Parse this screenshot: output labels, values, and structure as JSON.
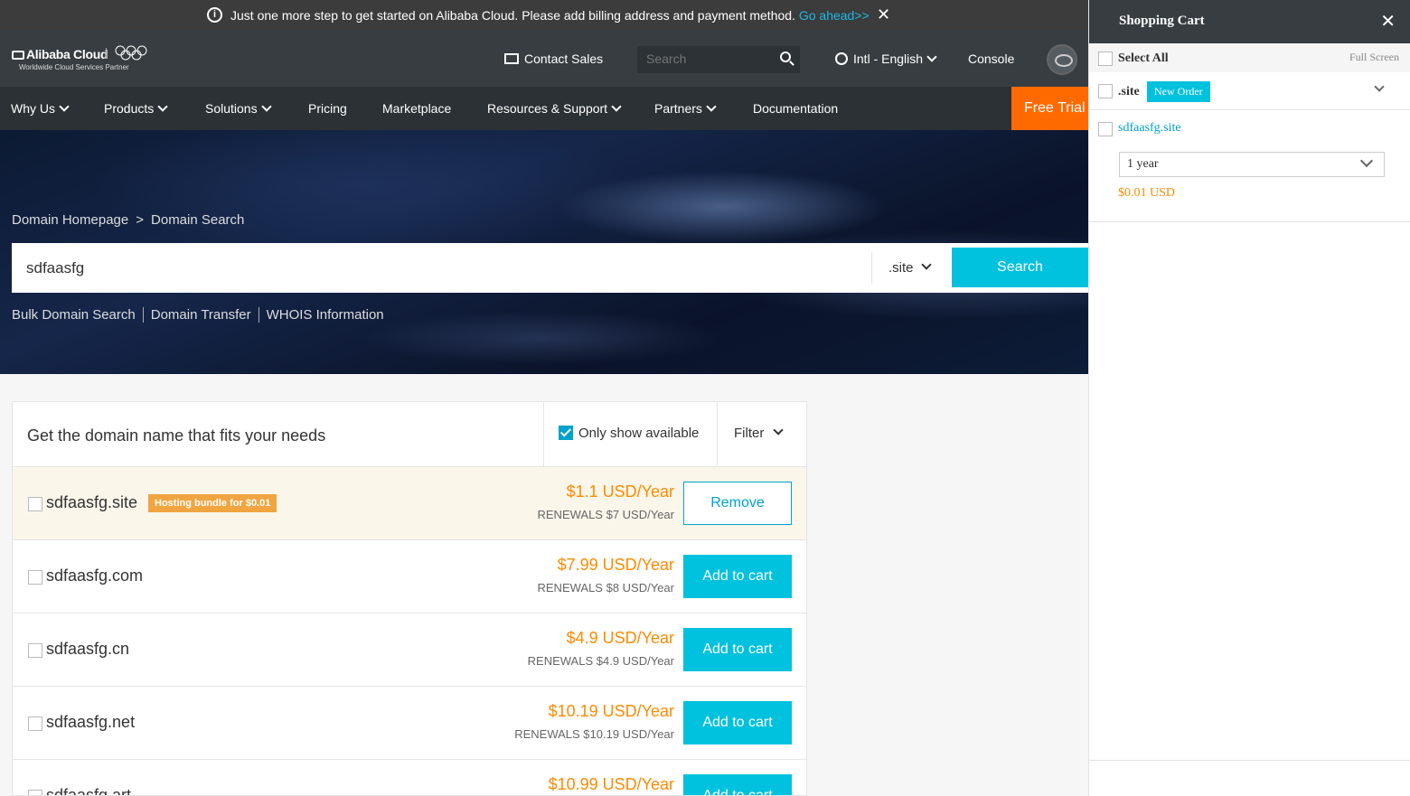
{
  "notice": {
    "text": "Just one more step to get started on Alibaba Cloud. Please add billing address and payment method.",
    "link": "Go ahead>>"
  },
  "header": {
    "brand": "Alibaba Cloud",
    "tagline": "Worldwide Cloud Services Partner",
    "contact": "Contact Sales",
    "search_placeholder": "Search",
    "language": "Intl - English",
    "console": "Console"
  },
  "nav": {
    "items": [
      "Why Us",
      "Products",
      "Solutions",
      "Pricing",
      "Marketplace",
      "Resources & Support",
      "Partners",
      "Documentation"
    ],
    "free_trial": "Free Trial"
  },
  "hero": {
    "breadcrumb": [
      "Domain Homepage",
      ">",
      "Domain Search"
    ],
    "query": "sdfaasfg",
    "tld": ".site",
    "search_button": "Search",
    "links": [
      "Bulk Domain Search",
      "Domain Transfer",
      "WHOIS Information"
    ]
  },
  "results": {
    "title": "Get the domain name that fits your needs",
    "only_available": "Only show available",
    "filter": "Filter",
    "rows": [
      {
        "name": "sdfaasfg.site",
        "badge": "Hosting bundle for $0.01",
        "price": "$1.1 USD/Year",
        "renew": "RENEWALS $7 USD/Year",
        "action": "Remove"
      },
      {
        "name": "sdfaasfg.com",
        "price": "$7.99 USD/Year",
        "renew": "RENEWALS $8 USD/Year",
        "action": "Add to cart"
      },
      {
        "name": "sdfaasfg.cn",
        "price": "$4.9 USD/Year",
        "renew": "RENEWALS $4.9 USD/Year",
        "action": "Add to cart"
      },
      {
        "name": "sdfaasfg.net",
        "price": "$10.19 USD/Year",
        "renew": "RENEWALS $10.19 USD/Year",
        "action": "Add to cart"
      },
      {
        "name": "sdfaasfg.art",
        "price": "$10.99 USD/Year",
        "renew": "",
        "action": "Add to cart"
      }
    ]
  },
  "cart": {
    "title": "Shopping Cart",
    "select_all": "Select All",
    "full_screen": "Full Screen",
    "group_label": ".site",
    "group_badge": "New Order",
    "item_domain": "sdfaasfg.site",
    "duration": "1 year",
    "item_price": "$0.01 USD"
  },
  "colors": {
    "accent": "#00c1de",
    "price": "#ff8a00",
    "free_trial": "#ff6a00",
    "header_bg": "#373d41"
  }
}
